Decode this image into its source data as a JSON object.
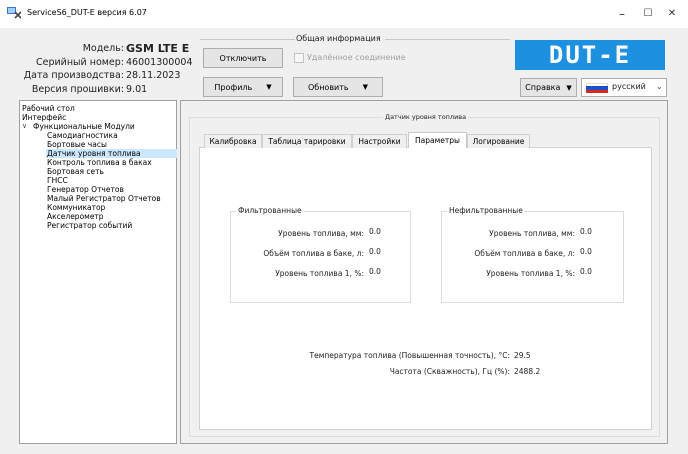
{
  "window": {
    "title": "ServiceS6_DUT-E версия 6.07",
    "min_symbol": "–",
    "max_symbol": "☐",
    "close_symbol": "✕"
  },
  "info": {
    "group_title": "Общая информация",
    "model_label": "Модель:",
    "model_value": "GSM LTE E",
    "serial_label": "Серийный номер:",
    "serial_value": "46001300004",
    "date_label": "Дата производства:",
    "date_value": "28.11.2023",
    "firmware_label": "Версия прошивки:",
    "firmware_value": "9.01",
    "disconnect_label": "Отключить",
    "remote_label": "Удалённое соединение",
    "profile_label": "Профиль",
    "refresh_label": "Обновить",
    "help_label": "Справка",
    "language_label": "русский",
    "logo_text": "DUT-E"
  },
  "tree": {
    "items": [
      {
        "label": "Рабочий стол"
      },
      {
        "label": "Интерфейс"
      },
      {
        "label": "Функциональные Модули"
      },
      {
        "label": "Самодиагностика"
      },
      {
        "label": "Бортовые часы"
      },
      {
        "label": "Датчик уровня топлива"
      },
      {
        "label": "Контроль топлива в баках"
      },
      {
        "label": "Бортовая сеть"
      },
      {
        "label": "ГНСС"
      },
      {
        "label": "Генератор Отчетов"
      },
      {
        "label": "Малый Регистратор Отчетов"
      },
      {
        "label": "Коммуникатор"
      },
      {
        "label": "Акселерометр"
      },
      {
        "label": "Регистратор событий"
      }
    ]
  },
  "sensor": {
    "group_title": "Датчик уровня топлива",
    "tabs": [
      {
        "label": "Калибровка"
      },
      {
        "label": "Таблица тарировки"
      },
      {
        "label": "Настройки"
      },
      {
        "label": "Параметры"
      },
      {
        "label": "Логирование"
      }
    ],
    "filtered": {
      "title": "Фильтрованные",
      "level_mm_label": "Уровень топлива, мм:",
      "level_mm_value": "0.0",
      "volume_label": "Объём топлива в баке, л:",
      "volume_value": "0.0",
      "level_pct_label": "Уровень топлива 1, %:",
      "level_pct_value": "0.0"
    },
    "unfiltered": {
      "title": "Нефильтрованные",
      "level_mm_label": "Уровень топлива, мм:",
      "level_mm_value": "0.0",
      "volume_label": "Объём топлива в баке, л:",
      "volume_value": "0.0",
      "level_pct_label": "Уровень топлива 1, %:",
      "level_pct_value": "0.0"
    },
    "temperature_label": "Температура топлива (Повышенная точность), °C:",
    "temperature_value": "29.5",
    "frequency_label": "Частота (Скважность), Гц (%):",
    "frequency_value": "2488.2"
  }
}
